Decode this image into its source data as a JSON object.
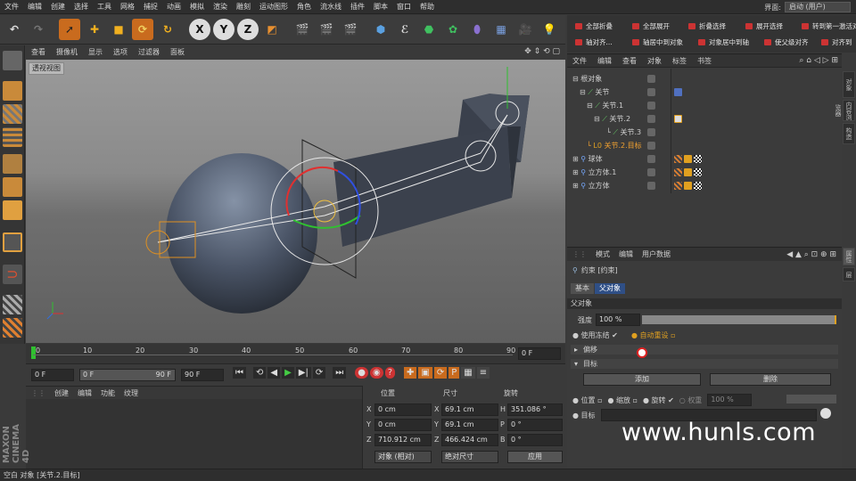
{
  "menubar": {
    "items": [
      "文件",
      "编辑",
      "创建",
      "选择",
      "工具",
      "网格",
      "捕捉",
      "动画",
      "模拟",
      "渲染",
      "雕刻",
      "运动图形",
      "角色",
      "流水线",
      "插件",
      "脚本",
      "窗口",
      "帮助"
    ],
    "layout_label": "界面:",
    "layout_value": "启动 (用户)"
  },
  "toolbar": {
    "axis_x": "X",
    "axis_y": "Y",
    "axis_z": "Z"
  },
  "viewport": {
    "menu": [
      "查看",
      "摄像机",
      "显示",
      "选项",
      "过滤器",
      "面板"
    ],
    "view_label": "透视视图"
  },
  "timeline": {
    "ticks": [
      "0",
      "10",
      "20",
      "30",
      "40",
      "50",
      "60",
      "70",
      "80",
      "90"
    ],
    "end_field": "0 F"
  },
  "time_controls": {
    "current": "0 F",
    "range_start": "0 F",
    "range_end": "90 F",
    "max": "90 F"
  },
  "material_panel": {
    "menu": [
      "创建",
      "编辑",
      "功能",
      "纹理"
    ]
  },
  "coords": {
    "headers": [
      "位置",
      "尺寸",
      "旋转"
    ],
    "rows": [
      {
        "axis": "X",
        "pos": "0 cm",
        "size_axis": "X",
        "size": "69.1 cm",
        "rot_axis": "H",
        "rot": "351.086 °"
      },
      {
        "axis": "Y",
        "pos": "0 cm",
        "size_axis": "Y",
        "size": "69.1 cm",
        "rot_axis": "P",
        "rot": "0 °"
      },
      {
        "axis": "Z",
        "pos": "710.912 cm",
        "size_axis": "Z",
        "size": "466.424 cm",
        "rot_axis": "B",
        "rot": "0 °"
      }
    ],
    "mode_object": "对象 (相对)",
    "mode_size": "绝对尺寸",
    "apply": "应用"
  },
  "right_top": {
    "buttons_row1": [
      "全部折叠",
      "全部展开",
      "折叠选择",
      "展开选择",
      "转到第一激活对象"
    ],
    "buttons_row2": [
      "轴对齐...",
      "轴居中到对象",
      "对象居中到轴",
      "使父级对齐",
      "对齐到"
    ]
  },
  "object_manager": {
    "menu": [
      "文件",
      "编辑",
      "查看",
      "对象",
      "标签",
      "书签"
    ],
    "rows": [
      {
        "name": "根对象",
        "indent": 6
      },
      {
        "name": "关节",
        "indent": 22
      },
      {
        "name": "关节.1",
        "indent": 36
      },
      {
        "name": "关节.2",
        "indent": 50
      },
      {
        "name": "关节.3",
        "indent": 60
      },
      {
        "name": "关节.2.目标",
        "indent": 34
      },
      {
        "name": "球体",
        "indent": 14
      },
      {
        "name": "立方体.1",
        "indent": 14
      },
      {
        "name": "立方体",
        "indent": 14
      }
    ]
  },
  "attr_manager": {
    "menu": [
      "模式",
      "编辑",
      "用户数据"
    ],
    "title": "约束 [约束]",
    "tabs": [
      "基本",
      "父对象"
    ],
    "section": "父对象",
    "strength_label": "强度",
    "strength_value": "100 %",
    "use_cache": "使用冻结",
    "auto_weight": "自动重设",
    "offset_section": "偏移",
    "target_section": "目标",
    "add": "添加",
    "remove": "删除",
    "pos": "位置",
    "scale": "缩放",
    "rot": "旋转",
    "weight_label": "权重",
    "weight_value": "100 %",
    "target": "目标"
  },
  "side_tabs": [
    "对象",
    "内容浏览器",
    "构造"
  ],
  "side_tabs2": [
    "属性",
    "层"
  ],
  "statusbar": "空白 对象 [关节.2.目标]",
  "watermark": "www.hunls.com",
  "logo": "MAXON CINEMA 4D"
}
